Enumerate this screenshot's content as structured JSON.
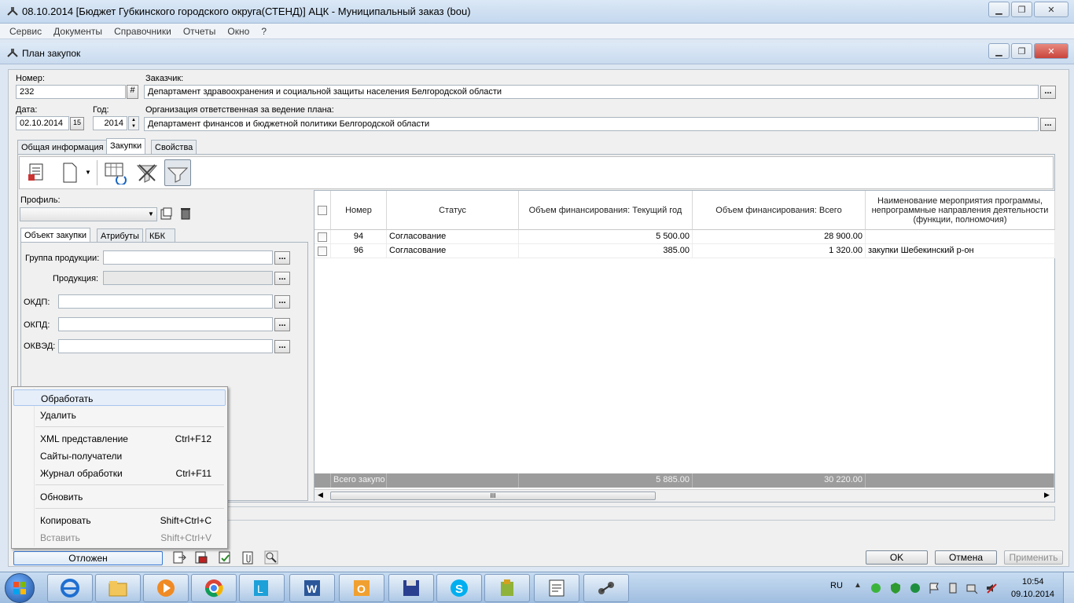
{
  "window": {
    "title": "08.10.2014 [Бюджет Губкинского городского округа(СТЕНД)] АЦК - Муниципальный заказ (bou)",
    "menu": [
      "Сервис",
      "Документы",
      "Справочники",
      "Отчеты",
      "Окно",
      "?"
    ]
  },
  "doc_window": {
    "title": "План закупок"
  },
  "header": {
    "number_label": "Номер:",
    "number_value": "232",
    "number_hash": "#",
    "customer_label": "Заказчик:",
    "customer_value": "Департамент здравоохранения и социальной защиты населения Белгородской области",
    "date_label": "Дата:",
    "date_value": "02.10.2014",
    "date_btn": "15",
    "year_label": "Год:",
    "year_value": "2014",
    "org_label": "Организация ответственная за ведение плана:",
    "org_value": "Департамент финансов и бюджетной политики Белгородской области",
    "ellipsis": "..."
  },
  "tabs": [
    "Общая информация",
    "Закупки",
    "Свойства"
  ],
  "active_tab": 1,
  "filter": {
    "profile_label": "Профиль:",
    "subtabs": [
      "Объект закупки",
      "Атрибуты",
      "КБК"
    ],
    "fields": [
      {
        "label": "Группа продукции:",
        "value": ""
      },
      {
        "label": "Продукция:",
        "value": ""
      },
      {
        "label": "ОКДП:",
        "value": ""
      },
      {
        "label": "ОКПД:",
        "value": ""
      },
      {
        "label": "ОКВЭД:",
        "value": ""
      }
    ]
  },
  "grid": {
    "columns": [
      "Номер",
      "Статус",
      "Объем финансирования: Текущий год",
      "Объем финансирования: Всего",
      "Наименование мероприятия программы, непрограммные направления деятельности (функции, полномочия)"
    ],
    "rows": [
      {
        "number": "94",
        "status": "Согласование",
        "current": "5 500.00",
        "total": "28 900.00",
        "name": ""
      },
      {
        "number": "96",
        "status": "Согласование",
        "current": "385.00",
        "total": "1 320.00",
        "name": "закупки Шебекинский р-он"
      }
    ],
    "totals": {
      "label": "Всего закупо",
      "current": "5 885.00",
      "total": "30 220.00"
    },
    "scroll_thumb": "III"
  },
  "context_menu": {
    "items": [
      {
        "label": "Обработать",
        "shortcut": "",
        "state": "highlighted"
      },
      {
        "label": "Удалить",
        "shortcut": "",
        "state": "normal"
      },
      {
        "label": "XML представление",
        "shortcut": "Ctrl+F12",
        "state": "normal"
      },
      {
        "label": "Сайты-получатели",
        "shortcut": "",
        "state": "normal"
      },
      {
        "label": "Журнал обработки",
        "shortcut": "Ctrl+F11",
        "state": "normal"
      },
      {
        "label": "Обновить",
        "shortcut": "",
        "state": "normal"
      },
      {
        "label": "Копировать",
        "shortcut": "Shift+Ctrl+C",
        "state": "normal"
      },
      {
        "label": "Вставить",
        "shortcut": "Shift+Ctrl+V",
        "state": "disabled"
      }
    ]
  },
  "footer": {
    "status": "Отложен",
    "ok": "OK",
    "cancel": "Отмена",
    "apply": "Применить"
  },
  "taskbar": {
    "lang": "RU",
    "time": "10:54",
    "date": "09.10.2014",
    "apps": [
      "ie-icon",
      "explorer-icon",
      "media-player-icon",
      "chrome-icon",
      "lync-icon",
      "word-icon",
      "outlook-icon",
      "save-app-icon",
      "skype-icon",
      "app-icon",
      "notepad-icon",
      "network-tool-icon"
    ]
  },
  "colors": {
    "title_bar": "#c9dbef",
    "close_button": "#c8433a",
    "grid_total_bg": "#9c9c9c",
    "menu_highlight": "#e6eef9"
  }
}
